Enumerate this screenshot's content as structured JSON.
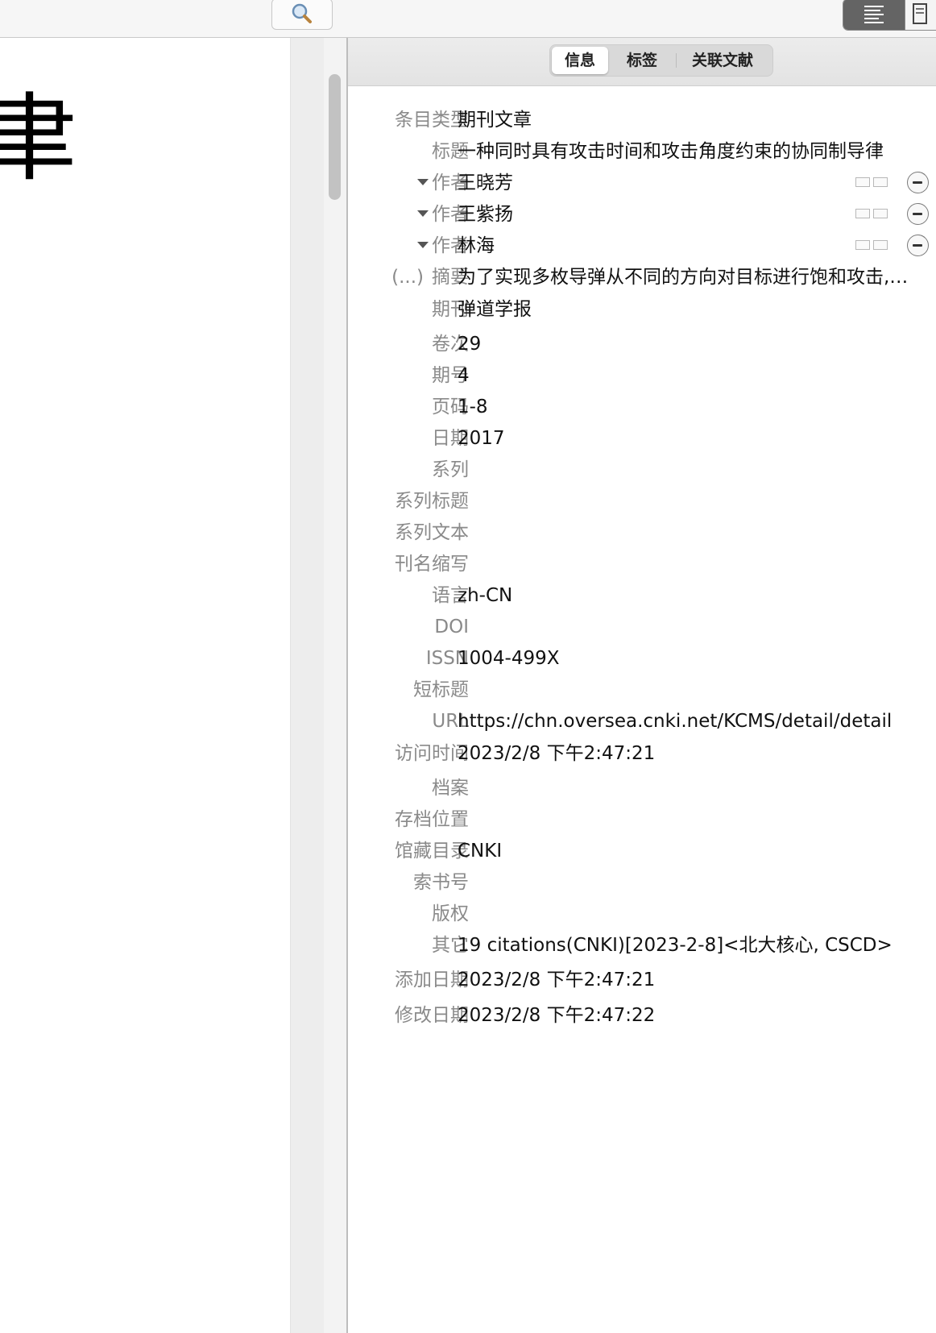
{
  "toolbar": {
    "search_icon": "magnifier-icon",
    "view_icons": [
      "list-view-icon",
      "document-view-icon"
    ]
  },
  "document": {
    "visible_glyph": "聿"
  },
  "tabs": [
    {
      "label": "信息",
      "selected": true
    },
    {
      "label": "标签",
      "selected": false
    },
    {
      "label": "关联文献",
      "selected": false
    }
  ],
  "fields": {
    "item_type": {
      "label": "条目类型",
      "value": "期刊文章"
    },
    "title": {
      "label": "标题",
      "value": "一种同时具有攻击时间和攻击角度约束的协同制导律"
    },
    "creators": [
      {
        "label": "作者",
        "value": "王晓芳"
      },
      {
        "label": "作者",
        "value": "王紫扬"
      },
      {
        "label": "作者",
        "value": "林海"
      }
    ],
    "abstract": {
      "label": "摘要",
      "prefix": "(...)",
      "value": "为了实现多枚导弹从不同的方向对目标进行饱和攻击,…"
    },
    "journal": {
      "label": "期刊",
      "value": "弹道学报"
    },
    "volume": {
      "label": "卷次",
      "value": "29"
    },
    "issue": {
      "label": "期号",
      "value": "4"
    },
    "pages": {
      "label": "页码",
      "value": "1-8"
    },
    "date": {
      "label": "日期",
      "value": "2017"
    },
    "series": {
      "label": "系列",
      "value": ""
    },
    "series_title": {
      "label": "系列标题",
      "value": ""
    },
    "series_text": {
      "label": "系列文本",
      "value": ""
    },
    "journal_abbr": {
      "label": "刊名缩写",
      "value": ""
    },
    "language": {
      "label": "语言",
      "value": "zh-CN"
    },
    "doi": {
      "label": "DOI",
      "value": ""
    },
    "issn": {
      "label": "ISSN",
      "value": "1004-499X"
    },
    "short_title": {
      "label": "短标题",
      "value": ""
    },
    "url": {
      "label": "URL",
      "value": "https://chn.oversea.cnki.net/KCMS/detail/detail"
    },
    "accessed": {
      "label": "访问时间",
      "value": "2023/2/8 下午2:47:21"
    },
    "archive": {
      "label": "档案",
      "value": ""
    },
    "archive_location": {
      "label": "存档位置",
      "value": ""
    },
    "library_catalog": {
      "label": "馆藏目录",
      "value": "CNKI"
    },
    "call_number": {
      "label": "索书号",
      "value": ""
    },
    "rights": {
      "label": "版权",
      "value": ""
    },
    "extra": {
      "label": "其它",
      "value": "19 citations(CNKI)[2023-2-8]<北大核心, CSCD>"
    },
    "date_added": {
      "label": "添加日期",
      "value": "2023/2/8 下午2:47:21"
    },
    "date_modified": {
      "label": "修改日期",
      "value": "2023/2/8 下午2:47:22"
    }
  }
}
